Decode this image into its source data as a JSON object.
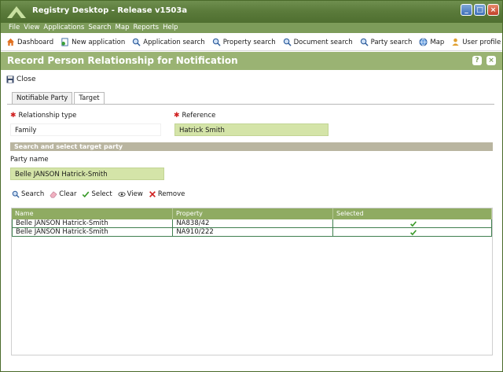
{
  "app": {
    "title": "Registry Desktop - Release v1503a"
  },
  "menu": [
    "File",
    "View",
    "Applications",
    "Search",
    "Map",
    "Reports",
    "Help"
  ],
  "toolbar": {
    "dashboard": "Dashboard",
    "new_application": "New application",
    "application_search": "Application search",
    "property_search": "Property search",
    "document_search": "Document search",
    "party_search": "Party search",
    "map": "Map",
    "user_profile": "User profile"
  },
  "form": {
    "title": "Record Person Relationship for Notification",
    "close_label": "Close",
    "tabs": [
      "Notifiable Party",
      "Target"
    ],
    "active_tab": "Target",
    "relationship_type": {
      "label": "Relationship type",
      "value": "Family"
    },
    "reference": {
      "label": "Reference",
      "value": "Hatrick Smith"
    },
    "section_title": "Search and select target party",
    "party_name": {
      "label": "Party name",
      "value": "Belle JANSON Hatrick-Smith"
    },
    "actions": {
      "search": "Search",
      "clear": "Clear",
      "select": "Select",
      "view": "View",
      "remove": "Remove"
    }
  },
  "table": {
    "columns": [
      "Name",
      "Property",
      "Selected"
    ],
    "rows": [
      {
        "name": "Belle JANSON Hatrick-Smith",
        "property": "NA838/42",
        "selected": true
      },
      {
        "name": "Belle JANSON Hatrick-Smith",
        "property": "NA910/222",
        "selected": true
      }
    ]
  },
  "colors": {
    "accent": "#9ab373",
    "header": "#8fab62",
    "field_green": "#d4e4a8",
    "check": "#3a9a2a"
  }
}
